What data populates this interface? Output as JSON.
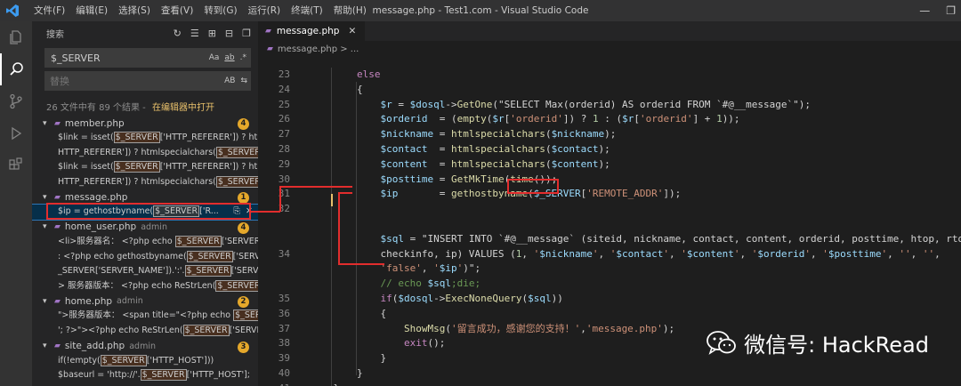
{
  "window": {
    "title": "message.php - Test1.com - Visual Studio Code",
    "menu": [
      "文件(F)",
      "编辑(E)",
      "选择(S)",
      "查看(V)",
      "转到(G)",
      "运行(R)",
      "终端(T)",
      "帮助(H)"
    ]
  },
  "activity_bar": [
    "files-icon",
    "search-icon",
    "source-control-icon",
    "run-debug-icon",
    "extensions-icon"
  ],
  "sidebar": {
    "title": "搜索",
    "search_value": "$_SERVER",
    "search_options": [
      "Aa",
      "ab",
      ".*"
    ],
    "replace_placeholder": "替换",
    "replace_option": "AB",
    "summary": "26 文件中有 89 个结果 - ",
    "open_in_editor": "在编辑器中打开",
    "files": [
      {
        "name": "member.php",
        "dir": "",
        "count": "4",
        "matches": [
          {
            "pre": "$link = isset(",
            "hl": "$_SERVER",
            "post": "['HTTP_REFERER']) ? htmls..."
          },
          {
            "pre": "HTTP_REFERER']) ? htmlspecialchars(",
            "hl": "$_SERVER",
            "post": "['H..."
          },
          {
            "pre": "$link = isset(",
            "hl": "$_SERVER",
            "post": "['HTTP_REFERER']) ? htmls..."
          },
          {
            "pre": "HTTP_REFERER']) ? htmlspecialchars(",
            "hl": "$_SERVER",
            "post": "['H..."
          }
        ]
      },
      {
        "name": "message.php",
        "dir": "",
        "count": "1",
        "matches": [
          {
            "pre": "$ip       = gethostbyname(",
            "hl": "$_SERVER",
            "post": "['R..."
          }
        ]
      },
      {
        "name": "home_user.php",
        "dir": "admin",
        "count": "4",
        "matches": [
          {
            "pre": "<li>服务器名：  <?php echo ",
            "hl": "$_SERVER",
            "post": "['SERVER_..."
          },
          {
            "pre": ":  <?php echo gethostbyname(",
            "hl": "$_SERVER",
            "post": "['SERVE..."
          },
          {
            "pre": "_SERVER['SERVER_NAME']).':'.",
            "hl": "$_SERVER",
            "post": "['SERVER_..."
          },
          {
            "pre": "> 服务器版本：  <?php echo ReStrLen(",
            "hl": "$_SERVER",
            "post": "['SER..."
          }
        ]
      },
      {
        "name": "home.php",
        "dir": "admin",
        "count": "2",
        "matches": [
          {
            "pre": "\">服务器版本：  <span title=\"<?php echo ",
            "hl": "$_SER...",
            "post": ""
          },
          {
            "pre": "'; ?>\"><?php echo ReStrLen(",
            "hl": "$_SERVER",
            "post": "['SERVER_..."
          }
        ]
      },
      {
        "name": "site_add.php",
        "dir": "admin",
        "count": "3",
        "matches": [
          {
            "pre": "if(!empty(",
            "hl": "$_SERVER",
            "post": "['HTTP_HOST']))"
          },
          {
            "pre": "$baseurl = 'http://'.",
            "hl": "$_SERVER",
            "post": "['HTTP_HOST'];"
          }
        ]
      }
    ]
  },
  "editor": {
    "tab_label": "message.php",
    "breadcrumb": "message.php > ...",
    "line_numbers": [
      "23",
      "24",
      "25",
      "26",
      "27",
      "28",
      "29",
      "30",
      "31",
      "32",
      "",
      "",
      "34",
      "",
      "",
      "35",
      "36",
      "37",
      "38",
      "39",
      "40",
      "41",
      "42"
    ],
    "lines": [
      "        else",
      "        {",
      "            $r = $dosql->GetOne(\"SELECT Max(orderid) AS orderid FROM `#@__message`\");",
      "            $orderid  = (empty($r['orderid']) ? 1 : ($r['orderid'] + 1));",
      "            $nickname = htmlspecialchars($nickname);",
      "            $contact  = htmlspecialchars($contact);",
      "            $content  = htmlspecialchars($content);",
      "            $posttime = GetMkTime(time());",
      "            $ip       = gethostbyname($_SERVER['REMOTE_ADDR']);",
      "",
      "",
      "            $sql = \"INSERT INTO `#@__message` (siteid, nickname, contact, content, orderid, posttime, htop, rtop,",
      "            checkinfo, ip) VALUES (1, '$nickname', '$contact', '$content', '$orderid', '$posttime', '', '',",
      "            'false', '$ip')\";",
      "            // echo $sql;die;",
      "            if($dosql->ExecNoneQuery($sql))",
      "            {",
      "                ShowMsg('留言成功，感谢您的支持！','message.php');",
      "                exit();",
      "            }",
      "        }",
      "    }"
    ]
  },
  "watermark": "微信号: HackRead",
  "colors": {
    "accent_red": "#e22d2d",
    "badge": "#e5a82b",
    "php_icon": "#a074c4"
  }
}
